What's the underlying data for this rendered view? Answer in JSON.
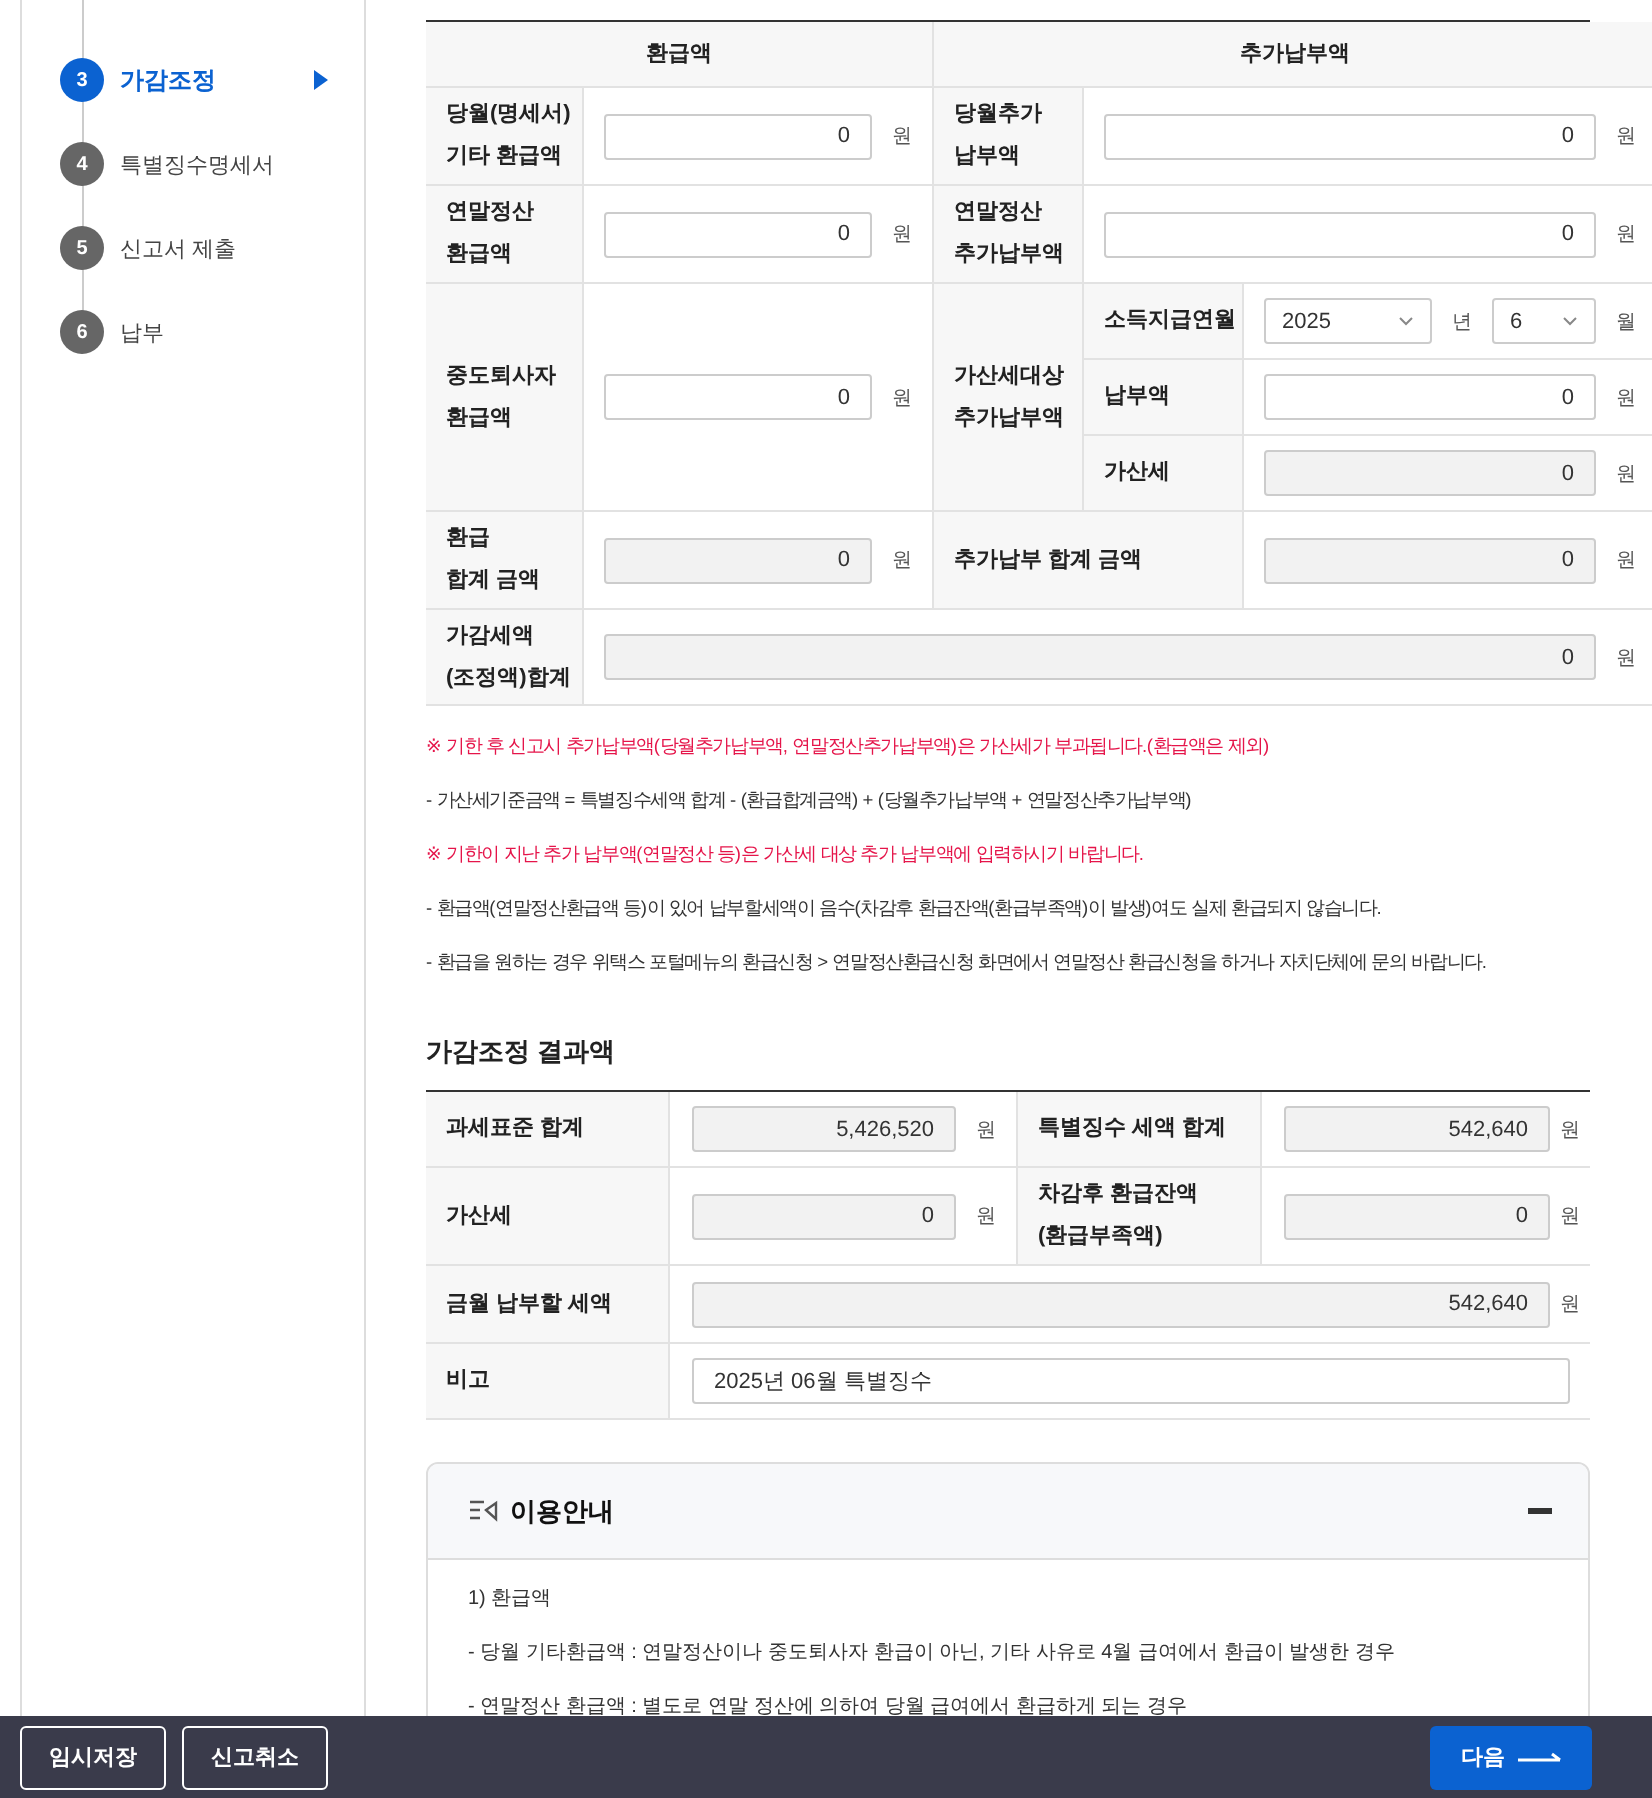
{
  "sidebar": {
    "steps": [
      {
        "number": "3",
        "label": "가감조정",
        "selected": true
      },
      {
        "number": "4",
        "label": "특별징수명세서",
        "selected": false
      },
      {
        "number": "5",
        "label": "신고서 제출",
        "selected": false
      },
      {
        "number": "6",
        "label": "납부",
        "selected": false
      }
    ]
  },
  "adjustment": {
    "headers": [
      "환급액",
      "추가납부액"
    ],
    "monthly_refund": {
      "label": "당월(명세서)\n기타 환급액",
      "value": "0",
      "unit": "원",
      "readonly": false
    },
    "monthly_additional": {
      "label": "당월추가\n납부액",
      "value": "0",
      "unit": "원",
      "readonly": false
    },
    "yearend_refund": {
      "label": "연말정산\n환급액",
      "value": "0",
      "unit": "원",
      "readonly": false
    },
    "yearend_additional": {
      "label": "연말정산\n추가납부액",
      "value": "0",
      "unit": "원",
      "readonly": false
    },
    "midterm_refund": {
      "label": "중도퇴사자\n환급액",
      "value": "0",
      "unit": "원",
      "readonly": false
    },
    "penalty_target": {
      "label": "가산세대상\n추가납부액",
      "pay_month": {
        "label": "소득지급연월",
        "year": "2025",
        "year_unit": "년",
        "month": "6",
        "month_unit": "월"
      },
      "payment": {
        "label": "납부액",
        "value": "0",
        "unit": "원",
        "readonly": false
      },
      "penalty": {
        "label": "가산세",
        "value": "0",
        "unit": "원",
        "readonly": true
      }
    },
    "refund_total": {
      "label": "환급\n합계 금액",
      "value": "0",
      "unit": "원",
      "readonly": true
    },
    "additional_total": {
      "label": "추가납부 합계 금액",
      "value": "0",
      "unit": "원",
      "readonly": true
    },
    "adjusted_total": {
      "label": "가감세액\n(조정액)합계",
      "value": "0",
      "unit": "원",
      "readonly": true
    }
  },
  "notes": [
    {
      "kind": "warning",
      "text": "※ 기한 후 신고시 추가납부액(당월추가납부액, 연말정산추가납부액)은 가산세가 부과됩니다.(환급액은 제외)"
    },
    {
      "kind": "plain",
      "text": "- 가산세기준금액 = 특별징수세액 합계 - (환급합계금액) + (당월추가납부액 + 연말정산추가납부액)"
    },
    {
      "kind": "warning",
      "text": "※ 기한이 지난 추가 납부액(연말정산 등)은 가산세 대상 추가 납부액에 입력하시기 바랍니다."
    },
    {
      "kind": "plain",
      "text": "- 환급액(연말정산환급액 등)이 있어 납부할세액이 음수(차감후 환급잔액(환급부족액)이 발생)여도 실제 환급되지 않습니다."
    },
    {
      "kind": "plain",
      "text": "- 환급을 원하는 경우 위택스 포털메뉴의 환급신청 > 연말정산환급신청 화면에서 연말정산 환급신청을 하거나 자치단체에 문의 바랍니다."
    }
  ],
  "result": {
    "title": "가감조정 결과액",
    "tax_base": {
      "label": "과세표준 합계",
      "value": "5,426,520",
      "unit": "원",
      "readonly": true
    },
    "special_tax": {
      "label": "특별징수 세액 합계",
      "value": "542,640",
      "unit": "원",
      "readonly": true
    },
    "penalty": {
      "label": "가산세",
      "value": "0",
      "unit": "원",
      "readonly": true
    },
    "refund_balance": {
      "label": "차감후 환급잔액\n(환급부족액)",
      "value": "0",
      "unit": "원",
      "readonly": true
    },
    "payable": {
      "label": "금월 납부할 세액",
      "value": "542,640",
      "unit": "원",
      "readonly": true
    },
    "remark": {
      "label": "비고",
      "value": "2025년 06월 특별징수",
      "readonly": false
    }
  },
  "guide": {
    "title": "이용안내",
    "expanded": true,
    "lines": [
      "1) 환급액",
      "- 당월 기타환급액 : 연말정산이나 중도퇴사자 환급이 아닌, 기타 사유로 4월 급여에서 환급이 발생한 경우",
      "- 연말정산 환급액 : 별도로 연말 정산에 의하여 당월 급여에서 환급하게 되는 경우"
    ]
  },
  "footer": {
    "buttons": [
      "임시저장",
      "신고취소"
    ],
    "next": "다음"
  }
}
